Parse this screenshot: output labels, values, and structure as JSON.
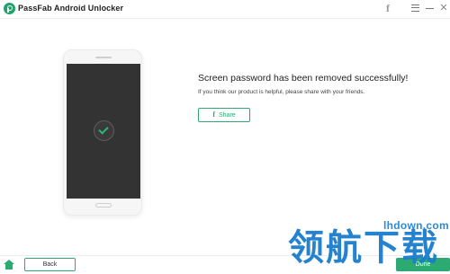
{
  "window": {
    "title": "PassFab Android Unlocker",
    "icons": [
      "app-logo-icon",
      "facebook-icon",
      "menu-icon",
      "minimize-icon",
      "close-icon"
    ],
    "close_glyph": "✕"
  },
  "result": {
    "headline": "Screen password has been removed successfully!",
    "subline": "If you think our product is helpful, please share with your friends.",
    "share_icon": "f",
    "share_label": "Share"
  },
  "footer": {
    "back_label": "Back",
    "done_label": "Done"
  },
  "watermark": {
    "domain": "lhdown.com",
    "text": "领航下载"
  },
  "colors": {
    "accent": "#2daa72",
    "screen": "#333333",
    "watermark": "#1a7ccd"
  }
}
